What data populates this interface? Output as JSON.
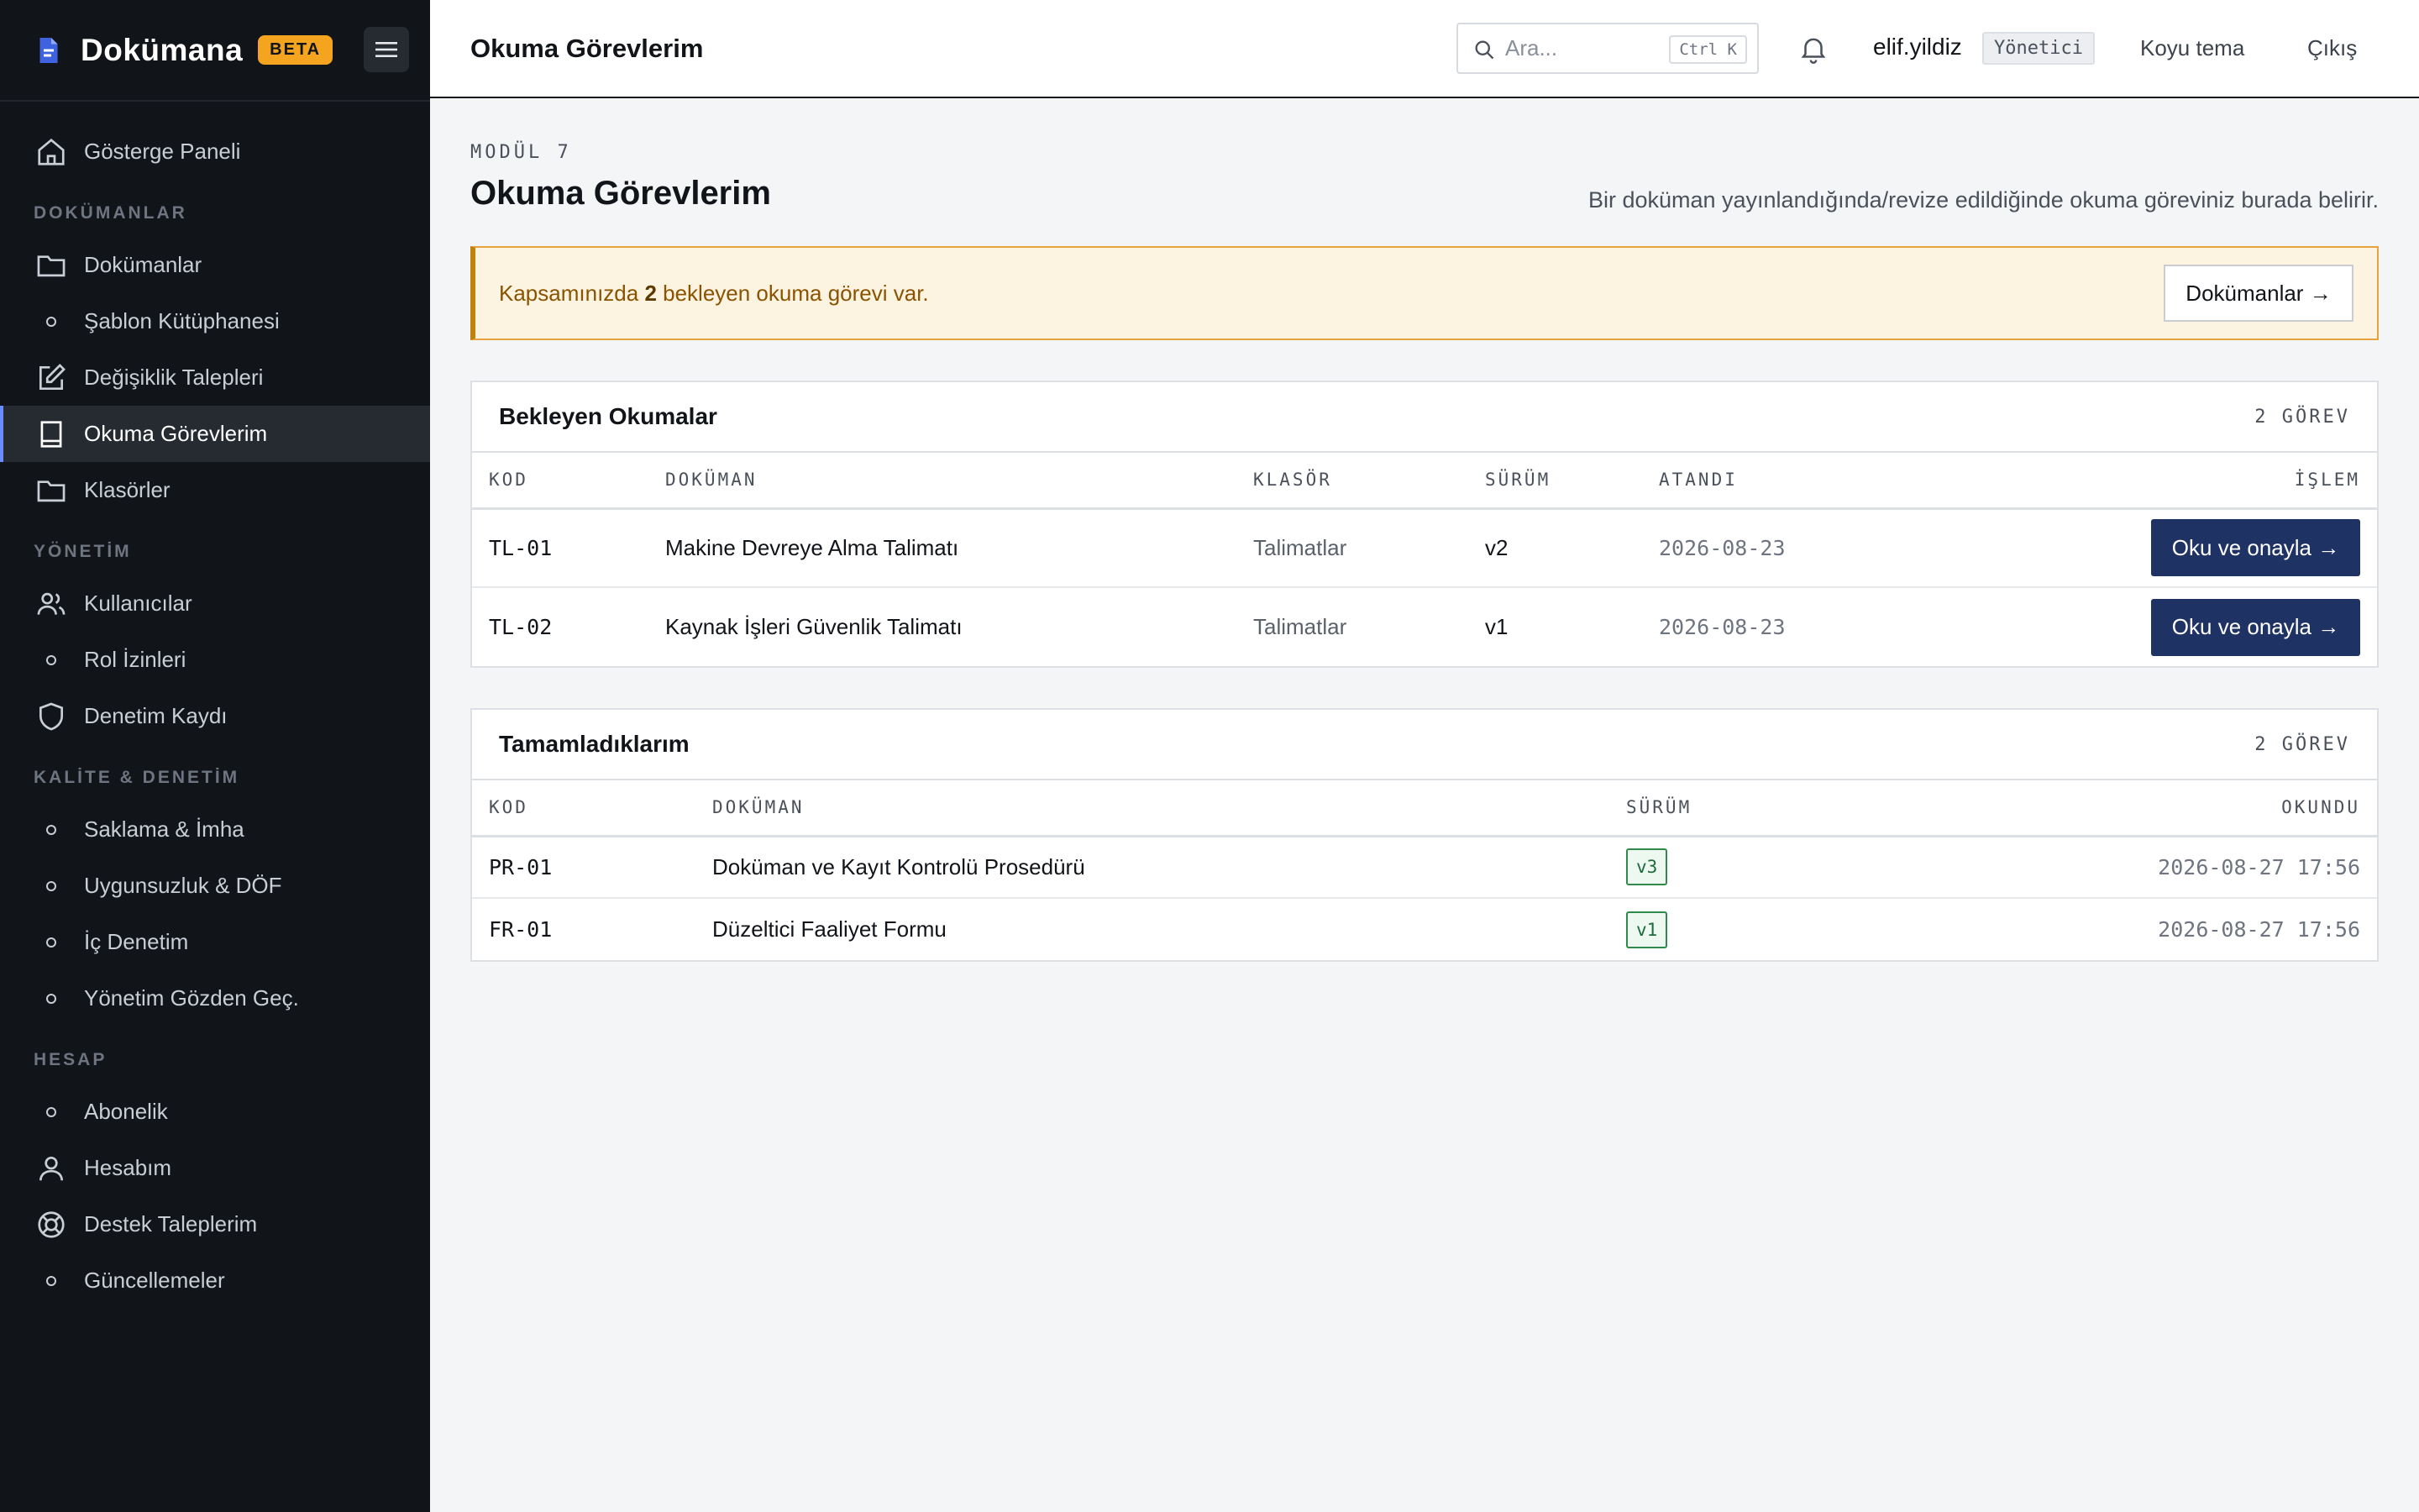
{
  "brand": {
    "name": "Dokümana",
    "badge": "BETA"
  },
  "sidebar": {
    "items": [
      {
        "label": "Gösterge Paneli"
      },
      {
        "section": "DOKÜMANLAR"
      },
      {
        "label": "Dokümanlar"
      },
      {
        "label": "Şablon Kütüphanesi"
      },
      {
        "label": "Değişiklik Talepleri"
      },
      {
        "label": "Okuma Görevlerim"
      },
      {
        "label": "Klasörler"
      },
      {
        "section": "YÖNETİM"
      },
      {
        "label": "Kullanıcılar"
      },
      {
        "label": "Rol İzinleri"
      },
      {
        "label": "Denetim Kaydı"
      },
      {
        "section": "KALİTE & DENETİM"
      },
      {
        "label": "Saklama & İmha"
      },
      {
        "label": "Uygunsuzluk & DÖF"
      },
      {
        "label": "İç Denetim"
      },
      {
        "label": "Yönetim Gözden Geç."
      },
      {
        "section": "HESAP"
      },
      {
        "label": "Abonelik"
      },
      {
        "label": "Hesabım"
      },
      {
        "label": "Destek Taleplerim"
      },
      {
        "label": "Güncellemeler"
      }
    ],
    "active": "Okuma Görevlerim"
  },
  "topbar": {
    "title": "Okuma Görevlerim",
    "search_placeholder": "Ara...",
    "search_shortcut": "Ctrl K",
    "username": "elif.yildiz",
    "role": "Yönetici",
    "theme_label": "Koyu tema",
    "logout_label": "Çıkış"
  },
  "page": {
    "module": "MODÜL 7",
    "title": "Okuma Görevlerim",
    "description": "Bir doküman yayınlandığında/revize edildiğinde okuma göreviniz burada belirir.",
    "alert": {
      "prefix": "Kapsamınızda ",
      "count": "2",
      "suffix": " bekleyen okuma görevi var.",
      "button": "Dokümanlar →"
    }
  },
  "pending": {
    "title": "Bekleyen Okumalar",
    "count": "2 GÖREV",
    "columns": [
      "KOD",
      "DOKÜMAN",
      "KLASÖR",
      "SÜRÜM",
      "ATANDI",
      "İŞLEM"
    ],
    "rows": [
      {
        "code": "TL-01",
        "document": "Makine Devreye Alma Talimatı",
        "folder": "Talimatlar",
        "version": "v2",
        "assigned": "2026-08-23",
        "action": "Oku ve onayla →"
      },
      {
        "code": "TL-02",
        "document": "Kaynak İşleri Güvenlik Talimatı",
        "folder": "Talimatlar",
        "version": "v1",
        "assigned": "2026-08-23",
        "action": "Oku ve onayla →"
      }
    ]
  },
  "completed": {
    "title": "Tamamladıklarım",
    "count": "2 GÖREV",
    "columns": [
      "KOD",
      "DOKÜMAN",
      "SÜRÜM",
      "OKUNDU"
    ],
    "rows": [
      {
        "code": "PR-01",
        "document": "Doküman ve Kayıt Kontrolü Prosedürü",
        "version": "v3",
        "read_at": "2026-08-27 17:56"
      },
      {
        "code": "FR-01",
        "document": "Düzeltici Faaliyet Formu",
        "version": "v1",
        "read_at": "2026-08-27 17:56"
      }
    ]
  },
  "colors": {
    "sidebar_bg": "#111419",
    "accent": "#1f3264",
    "badge": "#f5a41f",
    "alert_bg": "#fdf3e1",
    "alert_border": "#c0820a",
    "success": "#2f8a4b"
  }
}
